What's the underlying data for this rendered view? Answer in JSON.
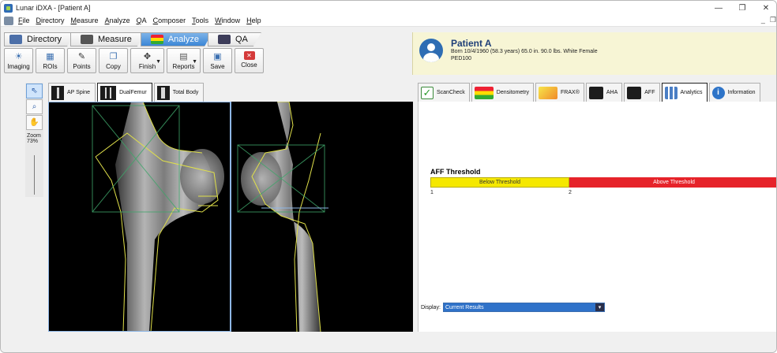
{
  "window": {
    "title": "Lunar iDXA - [Patient A]",
    "controls": {
      "minimize": "—",
      "restore": "❐",
      "close": "✕"
    },
    "mdi_controls": {
      "minimize": "_",
      "restore": "❐"
    }
  },
  "menu": [
    "File",
    "Directory",
    "Measure",
    "Analyze",
    "QA",
    "Composer",
    "Tools",
    "Window",
    "Help"
  ],
  "modes": [
    {
      "label": "Directory",
      "active": false
    },
    {
      "label": "Measure",
      "active": false
    },
    {
      "label": "Analyze",
      "active": true
    },
    {
      "label": "QA",
      "active": false
    }
  ],
  "toolbar": {
    "imaging": "Imaging",
    "rois": "ROIs",
    "points": "Points",
    "copy": "Copy",
    "finish": "Finish",
    "reports": "Reports",
    "save": "Save",
    "close": "Close"
  },
  "patient": {
    "name": "Patient A",
    "details": "Born 10/4/1960 (58.3 years)   65.0 in. 90.0 lbs.   White Female",
    "id": "PED100"
  },
  "side_tools": {
    "zoom_label": "Zoom",
    "zoom_value": "73%"
  },
  "image_tabs": [
    "AP Spine",
    "DualFemur",
    "Total Body"
  ],
  "result_tabs": [
    "ScanCheck",
    "Densitometry",
    "FRAX®",
    "AHA",
    "AFF",
    "Analytics",
    "Information"
  ],
  "aff": {
    "title": "AFF Threshold",
    "below_label": "Below Threshold",
    "above_label": "Above Threshold",
    "tick_1": "1",
    "tick_2": "2"
  },
  "display": {
    "label": "Display:",
    "value": "Current Results"
  },
  "colors": {
    "analyze_tab": "#3c86d6",
    "below": "#f5e800",
    "above": "#e6232a",
    "roi_outline": "#e0e04a"
  }
}
